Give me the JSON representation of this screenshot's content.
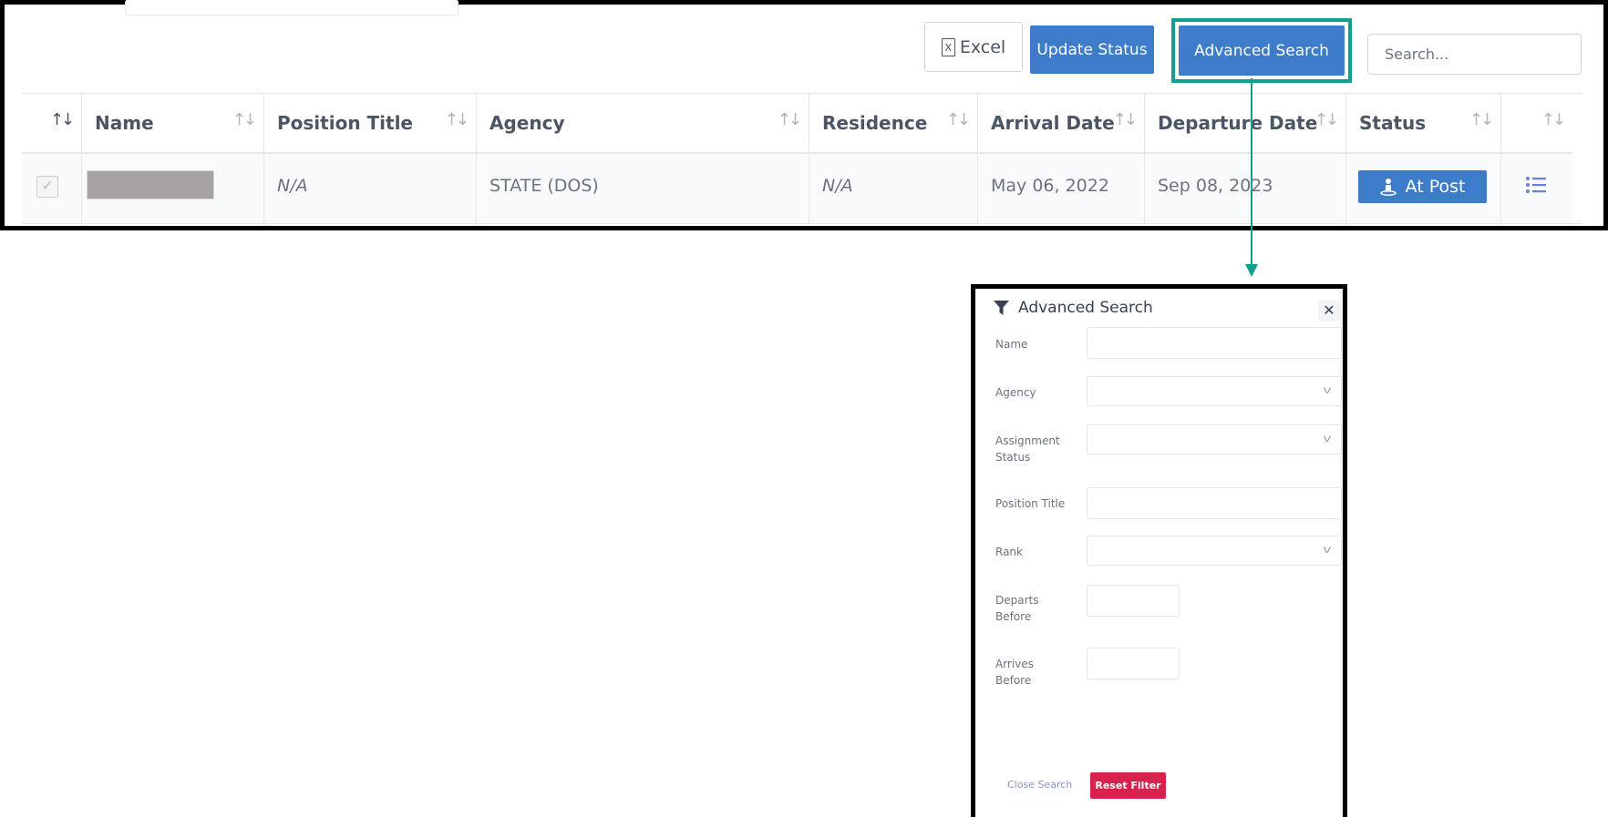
{
  "toolbar": {
    "excel_label": "Excel",
    "excel_icon_letter": "X",
    "update_status_label": "Update Status",
    "advanced_search_label": "Advanced Search",
    "search_placeholder": "Search..."
  },
  "table": {
    "columns": [
      {
        "label": "",
        "sort": "asc"
      },
      {
        "label": "Name",
        "sort": "none"
      },
      {
        "label": "Position Title",
        "sort": "none"
      },
      {
        "label": "Agency",
        "sort": "none"
      },
      {
        "label": "Residence",
        "sort": "none"
      },
      {
        "label": "Arrival Date",
        "sort": "none"
      },
      {
        "label": "Departure Date",
        "sort": "none"
      },
      {
        "label": "Status",
        "sort": "none"
      },
      {
        "label": "",
        "sort": "none"
      }
    ],
    "rows": [
      {
        "selected": true,
        "name": "",
        "position_title": "N/A",
        "agency": "STATE (DOS)",
        "residence": "N/A",
        "arrival_date": "May 06, 2022",
        "departure_date": "Sep 08, 2023",
        "status": "At Post"
      }
    ]
  },
  "advanced_search": {
    "title": "Advanced Search",
    "close_symbol": "✕",
    "fields": {
      "name": "Name",
      "agency": "Agency",
      "assignment_status": "Assignment Status",
      "position_title": "Position Title",
      "rank": "Rank",
      "departs_before": "Departs Before",
      "arrives_before": "Arrives Before"
    },
    "close_search_label": "Close Search",
    "reset_filter_label": "Reset Filter"
  },
  "colors": {
    "primary": "#3d7cc9",
    "highlight": "#10a090",
    "danger": "#d9214e"
  }
}
